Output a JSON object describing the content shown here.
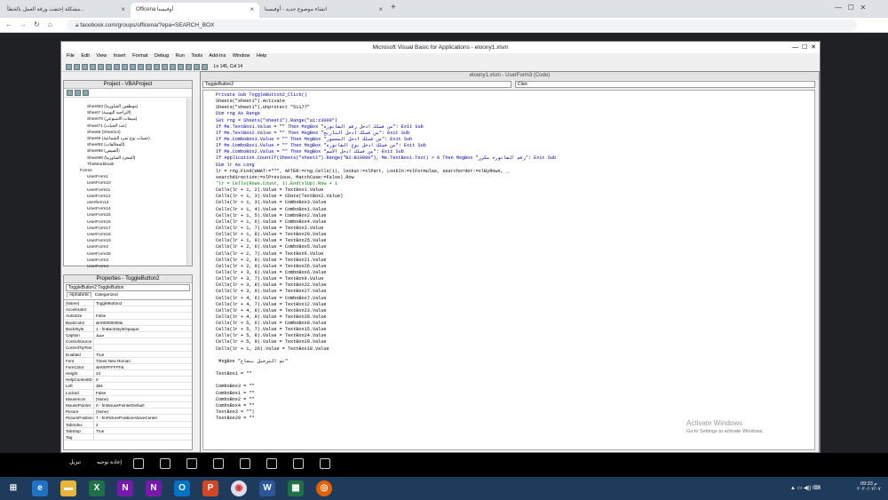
{
  "browser": {
    "tabs": [
      {
        "title": "مشكلة إختفت ورقة العمل بالخطأ...",
        "active": false
      },
      {
        "title": "Officena أوفيسنا",
        "active": true
      },
      {
        "title": "انشاء موضوع جديد - أوفيسنا",
        "active": false
      }
    ],
    "new_tab": "+",
    "url": "facebook.com/groups/officena/?epa=SEARCH_BOX"
  },
  "vba": {
    "title": "Microsoft Visual Basic for Applications - eloony1.xlsm",
    "menu": [
      "File",
      "Edit",
      "View",
      "Insert",
      "Format",
      "Debug",
      "Run",
      "Tools",
      "Add-Ins",
      "Window",
      "Help"
    ],
    "cursor_pos": "Ln 145, Col 14",
    "project": {
      "title": "Project - VBAProject",
      "items": [
        "Sheet63 (موظفين الشاورما)",
        "Sheet7 (التراجيه اليومية)",
        "Sheet70 (مبيعات الاسبوعي)",
        "Sheet71 (عدد الجبات)",
        "Sheet8 (Sheet14)",
        "Sheet9 (حساب نوع تمرد الشماعية)",
        "Sheet92 (المخالفات)",
        "Sheet96 (الصيص)",
        "Sheet99 (المجرد الشاورما)",
        "ThisWorkbook",
        "Forms",
        "UserForm1",
        "UserForm10",
        "UserForm11",
        "UserForm12",
        "userform13",
        "UserForm14",
        "UserForm15",
        "UserForm16",
        "UserForm17",
        "UserForm18",
        "UserForm19",
        "UserForm2",
        "UserForm20",
        "UserForm3",
        "UserForm4"
      ]
    },
    "properties": {
      "title": "Properties - ToggleButton2",
      "object": "ToggleButton2 ToggleButton",
      "tabs": [
        "Alphabetic",
        "Categorized"
      ],
      "rows": [
        [
          "(Name)",
          "ToggleButton2"
        ],
        [
          "Accelerator",
          ""
        ],
        [
          "AutoSize",
          "False"
        ],
        [
          "BackColor",
          "&H00000000&"
        ],
        [
          "BackStyle",
          "1 - fmBackStyleOpaque"
        ],
        [
          "Caption",
          "حفظ"
        ],
        [
          "ControlSource",
          ""
        ],
        [
          "ControlTipText",
          ""
        ],
        [
          "Enabled",
          "True"
        ],
        [
          "Font",
          "Times New Roman"
        ],
        [
          "ForeColor",
          "&H00FFFFFF&"
        ],
        [
          "Height",
          "24"
        ],
        [
          "HelpContextID",
          "0"
        ],
        [
          "Left",
          "384"
        ],
        [
          "Locked",
          "False"
        ],
        [
          "MouseIcon",
          "(None)"
        ],
        [
          "MousePointer",
          "0 - fmMousePointerDefault"
        ],
        [
          "Picture",
          "(None)"
        ],
        [
          "PicturePosition",
          "7 - fmPicturePositionAboveCenter"
        ],
        [
          "TabIndex",
          "2"
        ],
        [
          "TabStop",
          "True"
        ],
        [
          "Tag",
          ""
        ]
      ]
    },
    "code_window": {
      "title": "eloony1.xlsm - UserForm3 (Code)",
      "object_combo": "ToggleButton2",
      "proc_combo": "Click",
      "lines": [
        "Private Sub ToggleButton2_Click()",
        "Sheets(\"sheet1\").Activate",
        "Sheets(\"sheet1\").Unprotect \"51177\"",
        "Dim rng As Range",
        "Set rng = Sheets(\"sheet1\").Range(\"a1:z3000\")",
        "If Me.TextBox1.Value = \"\" Then MsgBox \"من فضلك ادخل رقم الفاتوره\": Exit Sub",
        "If Me.TextBox2.Value = \"\" Then MsgBox \"من فضلك ادخل التاريخ\": Exit Sub",
        "If Me.ComboBox3.Value = \"\" Then MsgBox \"من فضلك ادخل المحضور\": Exit Sub",
        "If Me.ComboBox1.Value = \"\" Then MsgBox \"من فضلك ادخل نوع الفاتوره\": Exit Sub",
        "If Me.ComboBox2.Value = \"\" Then MsgBox \"من فضلك ادخل الاسم\": Exit Sub",
        "If Application.CountIf(Sheets(\"sheet1\").Range(\"B2:B10000\"), Me.TextBox1.Text) > 0 Then MsgBox \"رقم الفاتوره مكرر\": Exit Sub",
        "Dim lr As Long",
        "lr = rng.Find(WHAT:=\"*\", AFTER:=rng.Cells(1), lookat:=xlPart, LookIn:=xlFormulas, searchorder:=xlByRows, _",
        "searchdirection:=xlPrevious, MatchCase:=False).Row",
        "'lr = Cells(Rows.Count, 1).End(xlUp).Row + 1",
        "Cells(lr + 1, 2).Value = TextBox1.Value",
        "Cells(lr + 1, 3).Value = CDate(TextBox2.Value)",
        "Cells(lr + 1, 3).Value = ComboBox3.Value",
        "Cells(lr + 1, 4).Value = ComboBox1.Value",
        "Cells(lr + 1, 5).Value = ComboBox2.Value",
        "Cells(lr + 1, 6).Value = ComboBox4.Value",
        "Cells(lr + 1, 7).Value = TextBox3.Value",
        "Cells(lr + 1, 8).Value = TextBox20.Value",
        "Cells(lr + 1, 9).Value = TextBox25.Value",
        "Cells(lr + 2, 6).Value = ComboBox5.Value",
        "Cells(lr + 2, 7).Value = TextBox6.Value",
        "Cells(lr + 2, 8).Value = TextBox21.Value",
        "Cells(lr + 2, 9).Value = TextBox26.Value",
        "Cells(lr + 3, 6).Value = ComboBox6.Value",
        "Cells(lr + 3, 7).Value = TextBox9.Value",
        "Cells(lr + 3, 8).Value = TextBox22.Value",
        "Cells(lr + 3, 9).Value = TextBox27.Value",
        "Cells(lr + 4, 6).Value = ComboBox7.Value",
        "Cells(lr + 4, 7).Value = TextBox12.Value",
        "Cells(lr + 4, 8).Value = TextBox23.Value",
        "Cells(lr + 4, 9).Value = TextBox28.Value",
        "Cells(lr + 5, 6).Value = ComboBox8.Value",
        "Cells(lr + 5, 7).Value = TextBox15.Value",
        "Cells(lr + 5, 8).Value = TextBox24.Value",
        "Cells(lr + 5, 9).Value = TextBox29.Value",
        "Cells(lr + 1, 26).Value = TextBox18.Value",
        "",
        " MsgBox \"تم الترحيل بنجاح\"",
        "",
        "TextBox1 = \"\"",
        "",
        "ComboBox3 = \"\"",
        "ComboBox1 = \"\"",
        "ComboBox2 = \"\"",
        "ComboBox4 = \"\"",
        "TextBox3 = \"\"|",
        "TextBox20 = \"\""
      ]
    }
  },
  "activate": {
    "title": "Activate Windows",
    "subtitle": "Go to Settings to activate Windows."
  },
  "facebook_bar": {
    "labels": [
      "تنزيل",
      "إعادة توجيه"
    ]
  },
  "taskbar": {
    "time": "09:33 م",
    "date": "٢٠٢٠/٠٢/٠٧",
    "apps": [
      "start",
      "ie",
      "explorer",
      "excel",
      "onenote",
      "onenote2",
      "outlook",
      "powerpoint",
      "chrome",
      "word",
      "excel2",
      "firefox"
    ]
  }
}
